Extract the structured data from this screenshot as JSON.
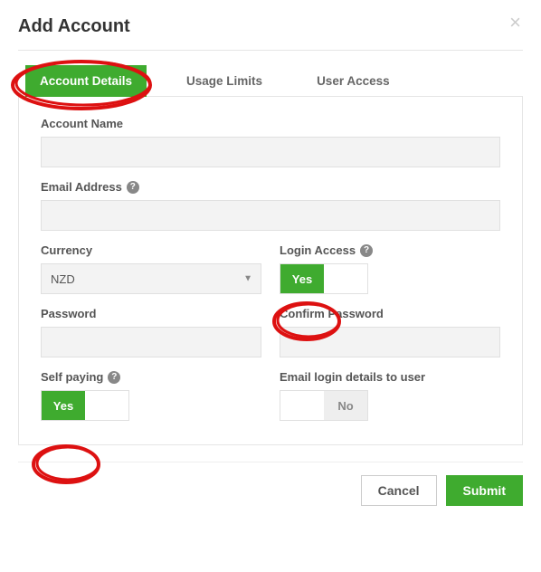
{
  "modal": {
    "title": "Add Account"
  },
  "tabs": {
    "account_details": "Account Details",
    "usage_limits": "Usage Limits",
    "user_access": "User Access"
  },
  "labels": {
    "account_name": "Account Name",
    "email_address": "Email Address",
    "currency": "Currency",
    "login_access": "Login Access",
    "password": "Password",
    "confirm_password": "Confirm Password",
    "self_paying": "Self paying",
    "email_login_details": "Email login details to user"
  },
  "values": {
    "account_name": "",
    "email_address": "",
    "currency": "NZD",
    "password": "",
    "confirm_password": ""
  },
  "toggles": {
    "yes": "Yes",
    "no": "No"
  },
  "buttons": {
    "cancel": "Cancel",
    "submit": "Submit"
  },
  "icons": {
    "help": "?"
  }
}
